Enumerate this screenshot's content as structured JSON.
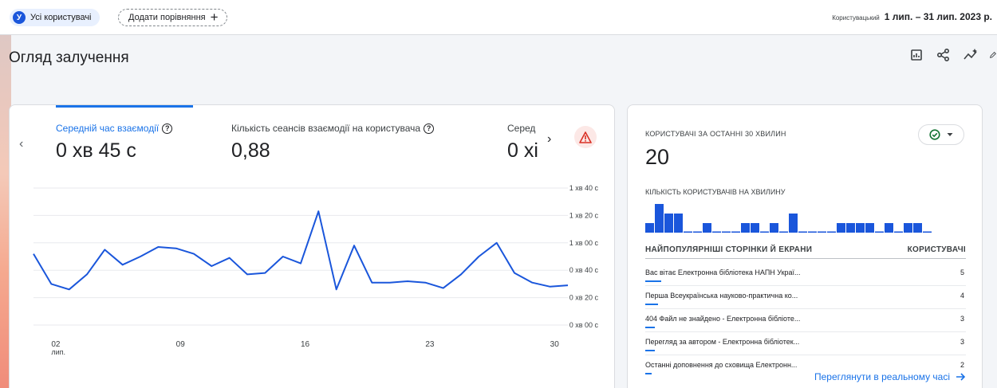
{
  "topbar": {
    "users_chip": {
      "avatar_letter": "У",
      "label": "Усі користувачі"
    },
    "compare_chip": {
      "label": "Додати порівняння",
      "plus": "+"
    },
    "date_mode": "Користувацький",
    "date_range": "1 лип. – 31 лип. 2023 р."
  },
  "page": {
    "title": "Огляд залучення"
  },
  "toolbar": {
    "icons": [
      "edit-report-icon",
      "share-icon",
      "insights-icon",
      "edit-icon"
    ]
  },
  "metrics": [
    {
      "label": "Середній час взаємодії",
      "value": "0 хв 45 с",
      "active": true
    },
    {
      "label": "Кількість сеансів взаємодії на користувача",
      "value": "0,88",
      "active": false
    },
    {
      "label": "Серед",
      "value": "0 хі",
      "active": false
    }
  ],
  "colors": {
    "accent": "#1a73e8",
    "series": "#1a56db",
    "warning": "#d93025"
  },
  "chart_data": {
    "type": "line",
    "x_ticks": [
      "02",
      "09",
      "16",
      "23",
      "30"
    ],
    "x_month": "лип.",
    "y_ticks": [
      "1 хв 40 с",
      "1 хв 20 с",
      "1 хв 00 с",
      "0 хв 40 с",
      "0 хв 20 с",
      "0 хв 00 с"
    ],
    "ylim": [
      0,
      100
    ],
    "y_unit": "seconds",
    "x": [
      "1",
      "2",
      "3",
      "4",
      "5",
      "6",
      "7",
      "8",
      "9",
      "10",
      "11",
      "12",
      "13",
      "14",
      "15",
      "16",
      "17",
      "18",
      "19",
      "20",
      "21",
      "22",
      "23",
      "24",
      "25",
      "26",
      "27",
      "28",
      "29",
      "30",
      "31"
    ],
    "series": [
      {
        "values": [
          52,
          30,
          26,
          37,
          55,
          44,
          50,
          57,
          56,
          52,
          43,
          49,
          37,
          38,
          50,
          45,
          83,
          26,
          58,
          31,
          31,
          32,
          31,
          27,
          37,
          50,
          60,
          38,
          31,
          28,
          29
        ]
      }
    ],
    "grid": true
  },
  "realtime": {
    "heading": "КОРИСТУВАЧІ ЗА ОСТАННІ 30 ХВИЛИН",
    "count": "20",
    "sub_heading": "КІЛЬКІСТЬ КОРИСТУВАЧІВ НА ХВИЛИНУ",
    "per_minute": [
      1,
      3,
      2,
      2,
      0,
      0,
      1,
      0,
      0,
      0,
      1,
      1,
      0,
      1,
      0,
      2,
      0,
      0,
      0,
      0,
      1,
      1,
      1,
      1,
      0,
      1,
      0,
      1,
      1,
      0
    ],
    "table_header": {
      "col1": "НАЙПОПУЛЯРНІШІ СТОРІНКИ Й ЕКРАНИ",
      "col2": "КОРИСТУВАЧІ"
    },
    "rows": [
      {
        "page": "Вас вітає Електронна бібліотека НАПН Украї...",
        "users": "5"
      },
      {
        "page": "Перша Всеукраїнська науково-практична ко...",
        "users": "4"
      },
      {
        "page": "404 Файл не знайдено - Електронна бібліоте...",
        "users": "3"
      },
      {
        "page": "Перегляд за автором - Електронна бібліотек...",
        "users": "3"
      },
      {
        "page": "Останні доповнення до сховища Електронн...",
        "users": "2"
      }
    ],
    "link": "Переглянути в реальному часі"
  }
}
